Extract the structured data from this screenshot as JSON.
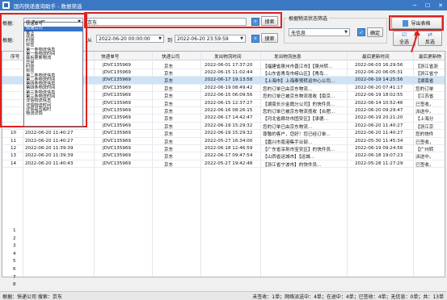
{
  "window": {
    "title": "国内快递查询助手 - 数据筛选",
    "minimize": "─",
    "maximize": "☐",
    "close": "✕"
  },
  "filter": {
    "label1": "根据:",
    "field_value": "快递公司",
    "keyword": "京东",
    "search_btn": "搜索",
    "label2": "根据:",
    "from_label": "从",
    "from_value": "2022-06-20 00:00:00",
    "to_label": "到",
    "to_value": "2022-06-20 23:59:59",
    "search_btn2": "搜索"
  },
  "dropdown_options": [
    "快递单号",
    "快递公司",
    "备注",
    "状态",
    "时效",
    "标签",
    "第一条物流信息",
    "第一条物流时间",
    "最后更新物流",
    "异常",
    "时效",
    "标签",
    "第二条物流信息",
    "第二条物流时间",
    "第四条物流信息",
    "第四条物流时间",
    "第三条物流信息",
    "第三条物流时间",
    "详情物流信息",
    "详情物流时间",
    "详情是否超时",
    "物流详情"
  ],
  "dropdown_selected": 1,
  "status_filter": {
    "title": "根据物流状态筛选",
    "value": "无信息",
    "ok": "确定"
  },
  "actions": {
    "export": "导出表格",
    "select_all": "全选",
    "invert": "反选"
  },
  "table": {
    "columns": [
      "序号",
      "",
      "快递单号",
      "快递公司",
      "发出物流时间",
      "发出物流信息",
      "最后更新时间",
      "最后更新物"
    ],
    "rows": [
      {
        "no": "",
        "added": "",
        "num": "JDVC135969",
        "co": "京东",
        "t1": "2022-06-01 17:37:20",
        "info": "【福建省泉州市晋江市】【泉州转...",
        "t2": "2022-06-03 16:29:56",
        "last": "【浙江省浙"
      },
      {
        "no": "",
        "added": "",
        "num": "JDVC135969",
        "co": "京东",
        "t1": "2022-06-15 11:02:44",
        "info": "【山东省青岛市崂山区】【青岛...",
        "t2": "2022-06-20 06:05:31",
        "last": "【浙江省宁"
      },
      {
        "no": "",
        "added": "",
        "num": "JDVC135969",
        "co": "京东",
        "t1": "2022-06-17 19:13:58",
        "info": "【上海市】上海奉贤转运中心公司...",
        "t2": "2022-06-19 14:25:56",
        "last": "【湖南省"
      },
      {
        "no": "",
        "added": "",
        "num": "JDVC135969",
        "co": "京东",
        "t1": "2022-06-19 08:49:42",
        "info": "您的订单已由京东物流...",
        "t2": "2022-06-20 07:41:17",
        "last": "您的订单"
      },
      {
        "no": "",
        "added": "",
        "num": "JDVC135969",
        "co": "京东",
        "t1": "2022-06-15 06:09:56",
        "info": "您的订单已被京东物流揽收【南京...",
        "t2": "2022-06-19 18:02:55",
        "last": "【江苏省"
      },
      {
        "no": "",
        "added": "",
        "num": "JDVC135969",
        "co": "京东",
        "t1": "2022-06-15 12:37:27",
        "info": "【湖南长沙金霞分公司】的快件员...",
        "t2": "2022-06-14 10:52:46",
        "last": "已签收，"
      },
      {
        "no": "",
        "added": "",
        "num": "JDVC135969",
        "co": "京东",
        "t1": "2022-06-16 08:26:15",
        "info": "您的订单已被京东物流揽收【合肥...",
        "t2": "2022-06-20 09:29:47",
        "last": "派送中，"
      },
      {
        "no": "",
        "added": "",
        "num": "JDVC135969",
        "co": "京东",
        "t1": "2022-06-17 14:42:47",
        "info": "【河北省廊坊市固安区】【承德...",
        "t2": "2022-06-19 20:21:20",
        "last": "【上海分"
      },
      {
        "no": "",
        "added": "",
        "num": "JDVC135969",
        "co": "京东",
        "t1": "2022-06-19 15:29:32",
        "info": "您的订单已由京东物流...",
        "t2": "2022-06-20 11:40:27",
        "last": "【浙江京"
      },
      {
        "no": "10",
        "added": "2022-06-20 11:40:27",
        "num": "JDVC135969",
        "co": "京东",
        "t1": "2022-06-19 15:29:32",
        "info": "尊敬的客户，您好！您已经订单...",
        "t2": "2022-06-20 11:40:27",
        "last": "您的快件"
      },
      {
        "no": "11",
        "added": "2022-06-20 11:40:27",
        "num": "JDVC135969",
        "co": "京东",
        "t1": "2022-05-27 16:34:00",
        "info": "【嘉兴市南港集手业部...",
        "t2": "2022-05-30 11:45:34",
        "last": "已签收，"
      },
      {
        "no": "12",
        "added": "2022-06-20 11:39:39",
        "num": "JDVC135969",
        "co": "京东",
        "t1": "2022-06-18 12:46:59",
        "info": "【广东省深圳市宝安区】的快件员...",
        "t2": "2022-06-19 09:24:56",
        "last": "【广州转"
      },
      {
        "no": "13",
        "added": "2022-06-20 11:39:39",
        "num": "JDVC135969",
        "co": "京东",
        "t1": "2022-06-17 09:47:54",
        "info": "【山西省运城市】【运城...",
        "t2": "2022-06-18 19:07:23",
        "last": "派送中，"
      },
      {
        "no": "14",
        "added": "2022-06-20 11:40:43",
        "num": "JDVC135969",
        "co": "京东",
        "t1": "2022-05-27 19:42:48",
        "info": "【浙江省宁波市】的快件员...",
        "t2": "2022-05-28 11:27:29",
        "last": "已签收，"
      }
    ],
    "bottom_numbers": [
      "1",
      "2",
      "3",
      "4",
      "5",
      "6",
      "7",
      "8"
    ]
  },
  "footer": {
    "left": "根据：快递公司  搜索：京东",
    "right": "未签收：1单；网络派送中：4单；在途中：4单；已签收：4单；无信息：0单；共：13单"
  }
}
